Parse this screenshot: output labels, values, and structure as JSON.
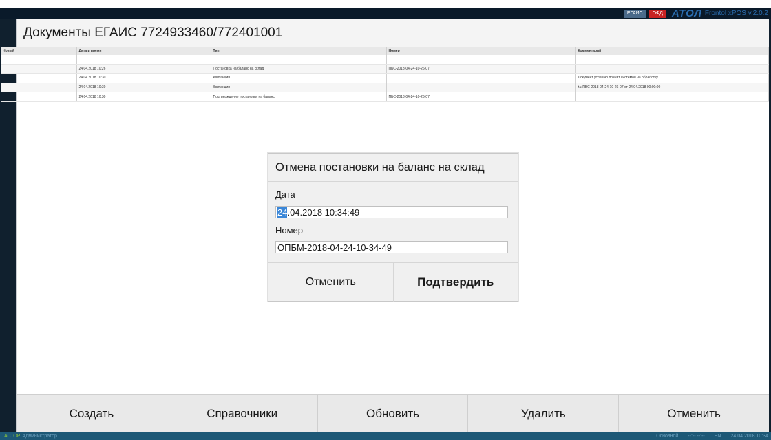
{
  "topbar": {
    "badge_egais": "ЕГАИС",
    "badge_ofd": "ОФД",
    "logo": "АТОЛ",
    "version": "Frontol xPOS v.2.0.2"
  },
  "page": {
    "title": "Документы ЕГАИС 7724933460/772401001"
  },
  "table": {
    "headers": [
      "Новый",
      "Дата и время",
      "Тип",
      "Номер",
      "Комментарий"
    ],
    "rows": [
      [
        "--",
        "--",
        "--",
        "--",
        "--"
      ],
      [
        "",
        "24.04.2018 10:26",
        "Постановка на баланс на склад",
        "ПБС-2018-04-24-10-26-07",
        ""
      ],
      [
        "",
        "24.04.2018 10:30",
        "Квитанция",
        "",
        "Документ успешно принят системой на обработку."
      ],
      [
        "",
        "24.04.2018 10:30",
        "Квитанция",
        "",
        "№ ПБС-2018-04-24-10-26-07 от 24.04.2018 00:00:00"
      ],
      [
        "",
        "24.04.2018 10:30",
        "Подтверждение постановки на баланс",
        "ПБС-2018-04-24-10-26-07",
        ""
      ]
    ]
  },
  "dialog": {
    "title": "Отмена постановки на баланс на склад",
    "date_label": "Дата",
    "date_selected": "24",
    "date_rest": ".04.2018 10:34:49",
    "number_label": "Номер",
    "number_value": "ОПБМ-2018-04-24-10-34-49",
    "cancel_label": "Отменить",
    "confirm_label": "Подтвердить"
  },
  "bottombar": {
    "create": "Создать",
    "references": "Справочники",
    "refresh": "Обновить",
    "delete": "Удалить",
    "cancel": "Отменить"
  },
  "statusbar": {
    "actor_label": "АСТОР",
    "user": "Администратор",
    "mode": "Основной",
    "placeholder": "--:-- --:--",
    "lang": "EN",
    "datetime": "24.04.2018 10:34"
  },
  "colors": {
    "accent": "#2a6db0",
    "status_bg": "#1d5876",
    "selection": "#3b87d8",
    "ofd_badge": "#c82323"
  }
}
